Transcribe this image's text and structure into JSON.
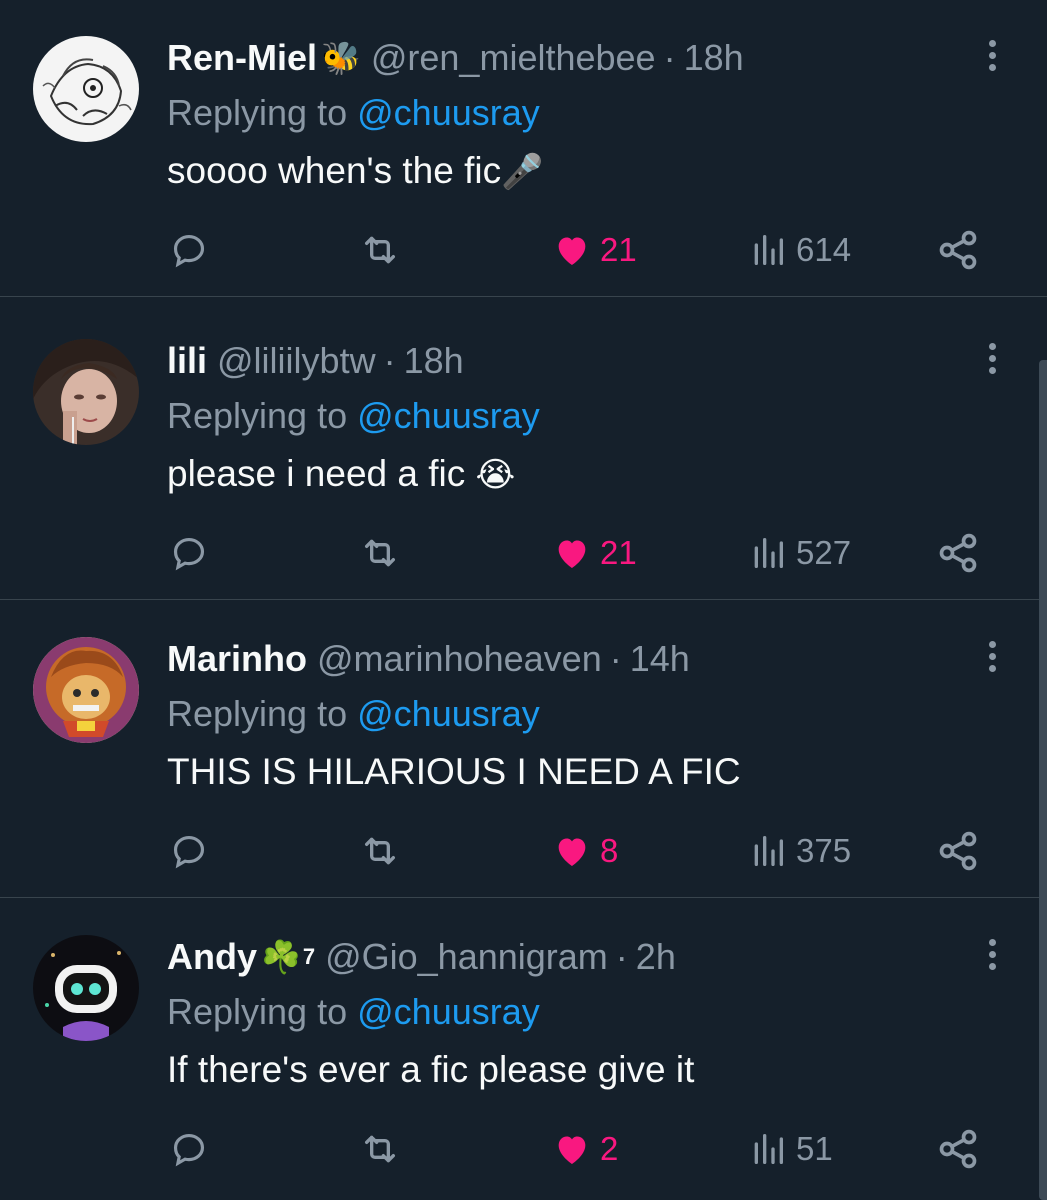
{
  "replying_label": "Replying to",
  "colors": {
    "background": "#15202b",
    "text": "#f7f9f9",
    "secondary": "#8b98a5",
    "link": "#1d9bf0",
    "like": "#f91880",
    "divider": "#38444d"
  },
  "tweets": [
    {
      "display_name": "Ren-Miel",
      "badge": "🐝",
      "handle": "@ren_mielthebee",
      "separator": "·",
      "time": "18h",
      "replying_to": "@chuusray",
      "text": "soooo when's the fic",
      "text_emoji": "🎤",
      "likes": "21",
      "views": "614",
      "liked": true,
      "avatar_icon": "sketch-avatar"
    },
    {
      "display_name": "lili",
      "badge": "",
      "handle": "@liliilybtw",
      "separator": "·",
      "time": "18h",
      "replying_to": "@chuusray",
      "text": "please i need a fic ",
      "text_emoji": "😭",
      "likes": "21",
      "views": "527",
      "liked": true,
      "avatar_icon": "portrait-avatar"
    },
    {
      "display_name": "Marinho",
      "badge": "",
      "handle": "@marinhoheaven",
      "separator": "·",
      "time": "14h",
      "replying_to": "@chuusray",
      "text": "THIS IS HILARIOUS I NEED A FIC",
      "text_emoji": "",
      "likes": "8",
      "views": "375",
      "liked": true,
      "avatar_icon": "cartoon-avatar"
    },
    {
      "display_name": "Andy",
      "badge": "☘️",
      "badge_sup": "7",
      "handle": "@Gio_hannigram",
      "separator": "·",
      "time": "2h",
      "replying_to": "@chuusray",
      "text": "If there's ever a fic please give it",
      "text_emoji": "",
      "likes": "2",
      "views": "51",
      "liked": true,
      "avatar_icon": "robot-avatar"
    }
  ]
}
